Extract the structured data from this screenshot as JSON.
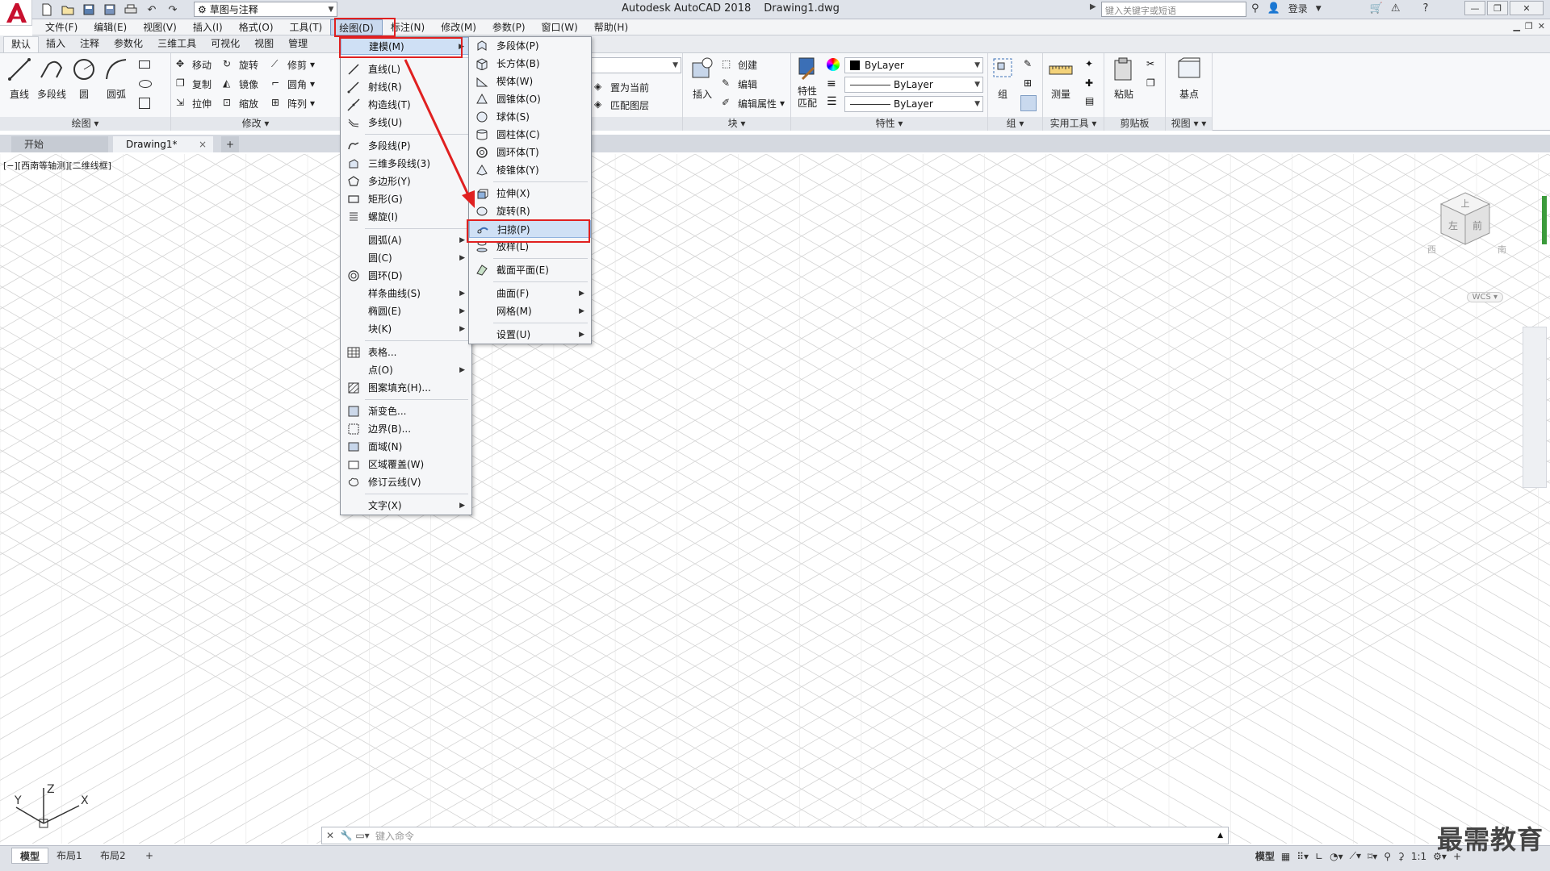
{
  "window": {
    "app_title": "Autodesk AutoCAD 2018",
    "file_title": "Drawing1.dwg",
    "workspace": "草图与注释",
    "search_placeholder": "键入关键字或短语",
    "login": "登录"
  },
  "menubar": {
    "items": [
      "文件(F)",
      "编辑(E)",
      "视图(V)",
      "插入(I)",
      "格式(O)",
      "工具(T)",
      "绘图(D)",
      "标注(N)",
      "修改(M)",
      "参数(P)",
      "窗口(W)",
      "帮助(H)"
    ],
    "active_index": 6
  },
  "ribbon": {
    "tabs": [
      "默认",
      "插入",
      "注释",
      "参数化",
      "三维工具",
      "可视化",
      "视图",
      "管理"
    ],
    "active_tab": 0,
    "draw_panel": {
      "title": "绘图",
      "tools": [
        "直线",
        "多段线",
        "圆",
        "圆弧"
      ]
    },
    "modify_panel": {
      "title": "修改",
      "tools": [
        "移动",
        "旋转",
        "修剪",
        "复制",
        "镜像",
        "圆角",
        "拉伸",
        "缩放",
        "阵列"
      ]
    },
    "layer_panel": {
      "tools": [
        "置为当前",
        "匹配图层"
      ]
    },
    "block_panel": {
      "title": "块",
      "insert": "插入",
      "tools": [
        "创建",
        "编辑",
        "编辑属性"
      ]
    },
    "props_panel": {
      "title": "特性",
      "match": "特性匹配",
      "match_lines": [
        "特性",
        "匹配"
      ],
      "color": "ByLayer",
      "linetype": "ByLayer",
      "lineweight": "ByLayer"
    },
    "group_panel": {
      "title": "组",
      "tool": "组"
    },
    "utilities_panel": {
      "title": "实用工具",
      "tool": "测量"
    },
    "clipboard_panel": {
      "title": "剪贴板",
      "tool": "粘贴"
    },
    "view_panel": {
      "title": "视图",
      "tool": "基点"
    }
  },
  "file_tabs": {
    "start": "开始",
    "drawing": "Drawing1*",
    "add": "+"
  },
  "canvas": {
    "viewport_label": "[−][西南等轴测][二维线框]",
    "wcs": "WCS",
    "viewcube_faces": [
      "上",
      "左",
      "前"
    ],
    "viewcube_compass": [
      "西",
      "南"
    ],
    "ucs_axes": [
      "X",
      "Y",
      "Z"
    ]
  },
  "command_line": {
    "placeholder": "键入命令"
  },
  "statusbar": {
    "layouts": [
      "模型",
      "布局1",
      "布局2"
    ],
    "add": "+",
    "model_label": "模型",
    "scale": "1:1"
  },
  "watermark": "最需教育",
  "draw_menu": {
    "items": [
      {
        "label": "建模(M)",
        "icon": "",
        "submenu": true,
        "highlighted": true
      },
      {
        "sep": true
      },
      {
        "label": "直线(L)",
        "icon": "line-icon"
      },
      {
        "label": "射线(R)",
        "icon": "ray-icon"
      },
      {
        "label": "构造线(T)",
        "icon": "xline-icon"
      },
      {
        "label": "多线(U)",
        "icon": "mline-icon"
      },
      {
        "sep": true
      },
      {
        "label": "多段线(P)",
        "icon": "polyline-icon"
      },
      {
        "label": "三维多段线(3)",
        "icon": "3dpoly-icon"
      },
      {
        "label": "多边形(Y)",
        "icon": "polygon-icon"
      },
      {
        "label": "矩形(G)",
        "icon": "rectangle-icon"
      },
      {
        "label": "螺旋(I)",
        "icon": "helix-icon"
      },
      {
        "sep": true
      },
      {
        "label": "圆弧(A)",
        "icon": "",
        "submenu": true
      },
      {
        "label": "圆(C)",
        "icon": "",
        "submenu": true
      },
      {
        "label": "圆环(D)",
        "icon": "donut-icon"
      },
      {
        "label": "样条曲线(S)",
        "icon": "",
        "submenu": true
      },
      {
        "label": "椭圆(E)",
        "icon": "",
        "submenu": true
      },
      {
        "label": "块(K)",
        "icon": "",
        "submenu": true
      },
      {
        "sep": true
      },
      {
        "label": "表格...",
        "icon": "table-icon"
      },
      {
        "label": "点(O)",
        "icon": "",
        "submenu": true
      },
      {
        "label": "图案填充(H)...",
        "icon": "hatch-icon"
      },
      {
        "sep": true
      },
      {
        "label": "渐变色...",
        "icon": "gradient-icon"
      },
      {
        "label": "边界(B)...",
        "icon": "boundary-icon"
      },
      {
        "label": "面域(N)",
        "icon": "region-icon"
      },
      {
        "label": "区域覆盖(W)",
        "icon": "wipeout-icon"
      },
      {
        "label": "修订云线(V)",
        "icon": "revcloud-icon"
      },
      {
        "sep": true
      },
      {
        "label": "文字(X)",
        "icon": "",
        "submenu": true
      }
    ]
  },
  "modeling_menu": {
    "items": [
      {
        "label": "多段体(P)",
        "icon": "polysolid-icon"
      },
      {
        "label": "长方体(B)",
        "icon": "box-icon"
      },
      {
        "label": "楔体(W)",
        "icon": "wedge-icon"
      },
      {
        "label": "圆锥体(O)",
        "icon": "cone-icon"
      },
      {
        "label": "球体(S)",
        "icon": "sphere-icon"
      },
      {
        "label": "圆柱体(C)",
        "icon": "cylinder-icon"
      },
      {
        "label": "圆环体(T)",
        "icon": "torus-icon"
      },
      {
        "label": "棱锥体(Y)",
        "icon": "pyramid-icon"
      },
      {
        "sep": true
      },
      {
        "label": "拉伸(X)",
        "icon": "extrude-icon"
      },
      {
        "label": "旋转(R)",
        "icon": "revolve-icon"
      },
      {
        "label": "扫掠(P)",
        "icon": "sweep-icon",
        "highlighted": true
      },
      {
        "label": "放样(L)",
        "icon": "loft-icon"
      },
      {
        "sep": true
      },
      {
        "label": "截面平面(E)",
        "icon": "section-plane-icon"
      },
      {
        "sep": true
      },
      {
        "label": "曲面(F)",
        "icon": "",
        "submenu": true
      },
      {
        "label": "网格(M)",
        "icon": "",
        "submenu": true
      },
      {
        "sep": true
      },
      {
        "label": "设置(U)",
        "icon": "",
        "submenu": true
      }
    ]
  },
  "colors": {
    "accent": "#e02020",
    "highlight": "#cfe0f5",
    "grid": "#d4d4d4"
  }
}
